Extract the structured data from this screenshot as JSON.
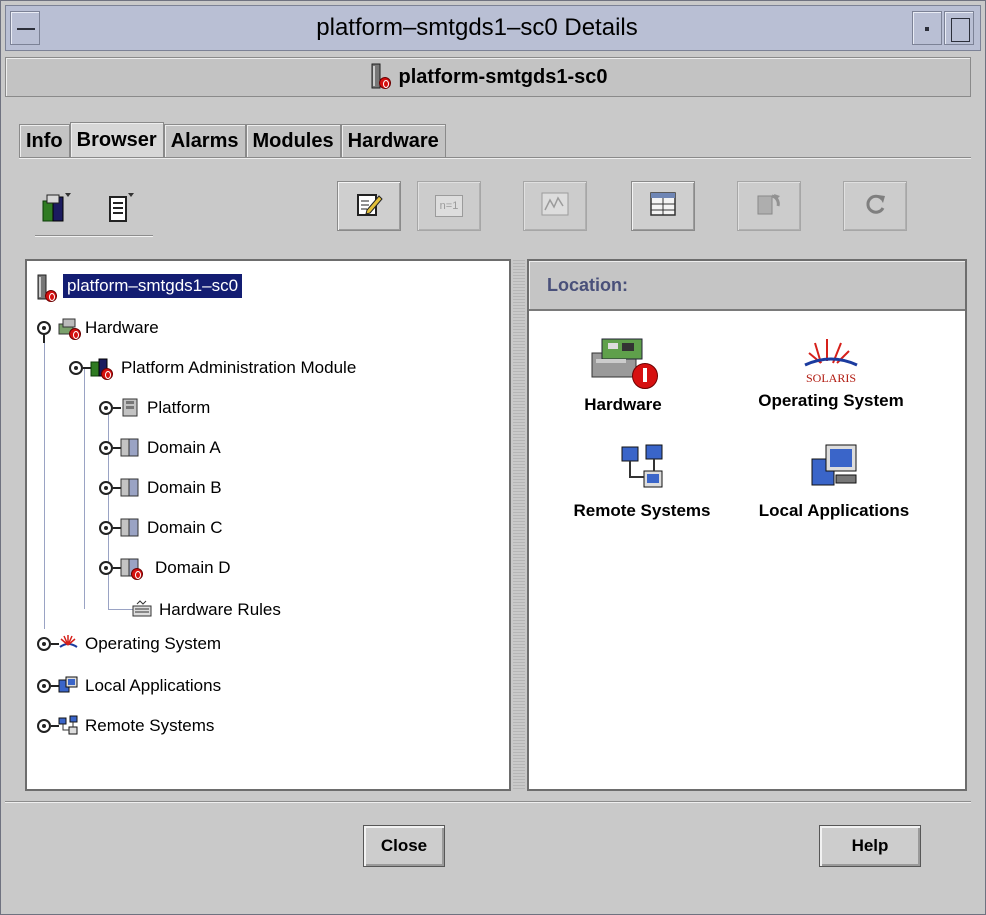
{
  "window": {
    "title": "platform–smtgds1–sc0 Details",
    "header_title": "platform-smtgds1-sc0"
  },
  "tabs": [
    {
      "label": "Info",
      "active": false
    },
    {
      "label": "Browser",
      "active": true
    },
    {
      "label": "Alarms",
      "active": false
    },
    {
      "label": "Modules",
      "active": false
    },
    {
      "label": "Hardware",
      "active": false
    }
  ],
  "toolbar": {
    "buttons": [
      {
        "icon": "edit-icon",
        "enabled": true
      },
      {
        "icon": "n-1-icon",
        "text": "n=1",
        "enabled": false
      },
      {
        "icon": "graph-icon",
        "enabled": false
      },
      {
        "icon": "table-view-icon",
        "enabled": true
      },
      {
        "icon": "refresh-config-icon",
        "enabled": false
      },
      {
        "icon": "reload-icon",
        "enabled": false
      }
    ]
  },
  "tree": {
    "root": {
      "label": "platform–smtgds1–sc0",
      "selected": true,
      "alarm": true
    },
    "items": [
      {
        "label": "Hardware",
        "alarm": true
      },
      {
        "label": "Platform Administration Module",
        "alarm": true
      },
      {
        "label": "Platform"
      },
      {
        "label": "Domain A"
      },
      {
        "label": "Domain B"
      },
      {
        "label": "Domain C"
      },
      {
        "label": "Domain D",
        "alarm": true
      },
      {
        "label": "Hardware Rules"
      },
      {
        "label": "Operating System"
      },
      {
        "label": "Local Applications"
      },
      {
        "label": "Remote Systems"
      }
    ]
  },
  "right_panel": {
    "location_label": "Location:",
    "solaris_logo_text": "SOLARIS",
    "icons": [
      {
        "label": "Hardware",
        "icon": "hardware-icon",
        "alarm": true
      },
      {
        "label": "Operating System",
        "icon": "solaris-icon"
      },
      {
        "label": "Remote Systems",
        "icon": "remote-systems-icon"
      },
      {
        "label": "Local Applications",
        "icon": "local-applications-icon"
      }
    ]
  },
  "buttons": {
    "close": "Close",
    "help": "Help"
  },
  "colors": {
    "selection_bg": "#131d72",
    "title_bar": "#b9bfd4",
    "location_label": "#49507a",
    "alarm": "#d61010"
  }
}
